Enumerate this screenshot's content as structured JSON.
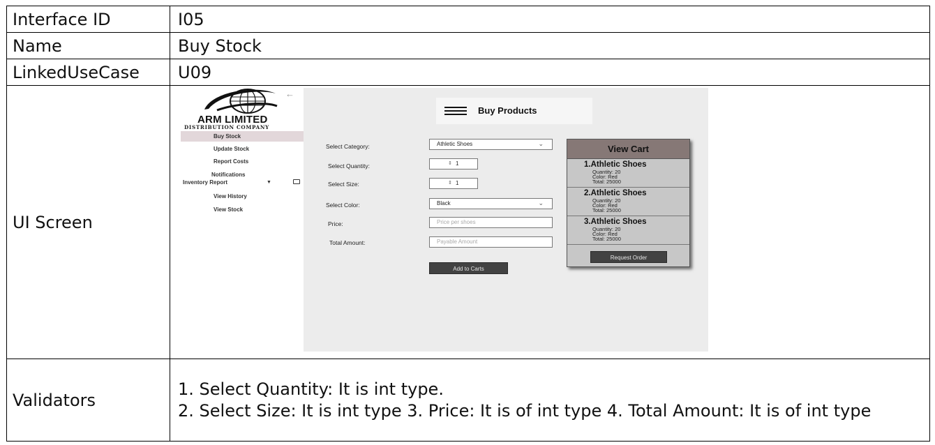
{
  "table": {
    "rows": [
      {
        "label": "Interface ID",
        "value": "I05"
      },
      {
        "label": "Name",
        "value": "Buy Stock"
      },
      {
        "label": "LinkedUseCase",
        "value": "U09"
      },
      {
        "label": "UI Screen"
      },
      {
        "label": "Validators",
        "lines": [
          "1. Select Quantity: It is int type.",
          "2. Select Size: It is int type 3. Price: It is of int type 4. Total Amount: It is of int type"
        ]
      }
    ]
  },
  "ui": {
    "brand": "ARM LIMITED",
    "brand_sub": "DISTRIBUTION COMPANY",
    "back_icon": "arrow-left-icon",
    "nav": [
      "Buy Stock",
      "Update Stock",
      "Report Costs",
      "Notifications",
      "Inventory Report",
      "View History",
      "View Stock"
    ],
    "active_nav": "Buy Stock",
    "header_title": "Buy Products",
    "form": {
      "category_label": "Select Category:",
      "category_value": "Athletic Shoes",
      "quantity_label": "Select Quantity:",
      "quantity_value": "1",
      "size_label": "Select Size:",
      "size_value": "1",
      "color_label": "Select Color:",
      "color_value": "Black",
      "price_label": "Price:",
      "price_placeholder": "Price per shoes",
      "total_label": "Total Amount:",
      "total_placeholder": "Payable Amount",
      "add_button": "Add to Carts"
    },
    "cart": {
      "title": "View Cart",
      "items": [
        {
          "name": "1.Athletic Shoes",
          "quantity": "Quantity: 20",
          "color": "Color: Red",
          "total": "Total: 25000"
        },
        {
          "name": "2.Athletic Shoes",
          "quantity": "Quantity: 20",
          "color": "Color: Red",
          "total": "Total: 25000"
        },
        {
          "name": "3.Athletic Shoes",
          "quantity": "Quantity: 20",
          "color": "Color: Red",
          "total": "Total: 25000"
        }
      ],
      "request_button": "Request Order"
    },
    "colors": {
      "cart_header": "#867876",
      "cart_body": "#c7c7c7",
      "active_nav": "#e2d7da",
      "button": "#424242"
    }
  }
}
